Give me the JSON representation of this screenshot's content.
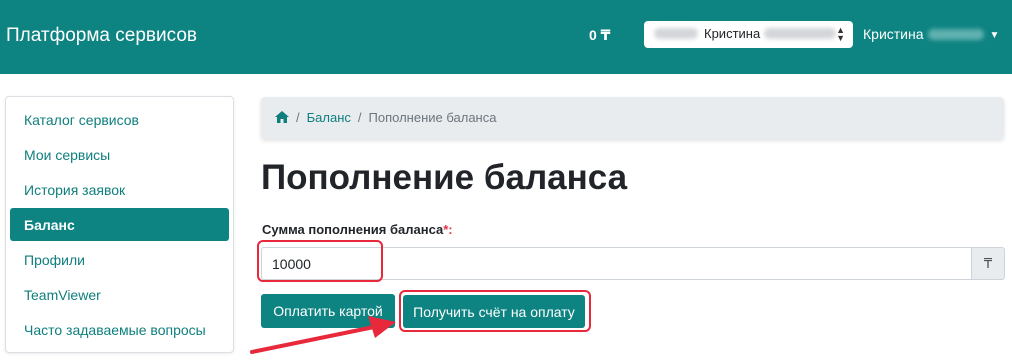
{
  "header": {
    "brand": "Платформа сервисов",
    "balance": "0 ₸",
    "profile_select": {
      "name": "Кристина"
    },
    "user_menu": {
      "name": "Кристина"
    }
  },
  "sidebar": {
    "items": [
      {
        "label": "Каталог сервисов",
        "active": false
      },
      {
        "label": "Мои сервисы",
        "active": false
      },
      {
        "label": "История заявок",
        "active": false
      },
      {
        "label": "Баланс",
        "active": true
      },
      {
        "label": "Профили",
        "active": false
      },
      {
        "label": "TeamViewer",
        "active": false
      },
      {
        "label": "Часто задаваемые вопросы",
        "active": false
      }
    ]
  },
  "breadcrumb": {
    "home_icon": "home-icon",
    "items": [
      "Баланс",
      "Пополнение баланса"
    ]
  },
  "main": {
    "title": "Пополнение баланса",
    "amount_label": "Сумма пополнения баланса",
    "required_mark": "*:",
    "amount_value": "10000",
    "currency": "₸",
    "pay_card_button": "Оплатить картой",
    "get_invoice_button": "Получить счёт на оплату"
  },
  "colors": {
    "accent": "#0e8482",
    "link": "#0e7f7d",
    "highlight": "#e8283b"
  }
}
